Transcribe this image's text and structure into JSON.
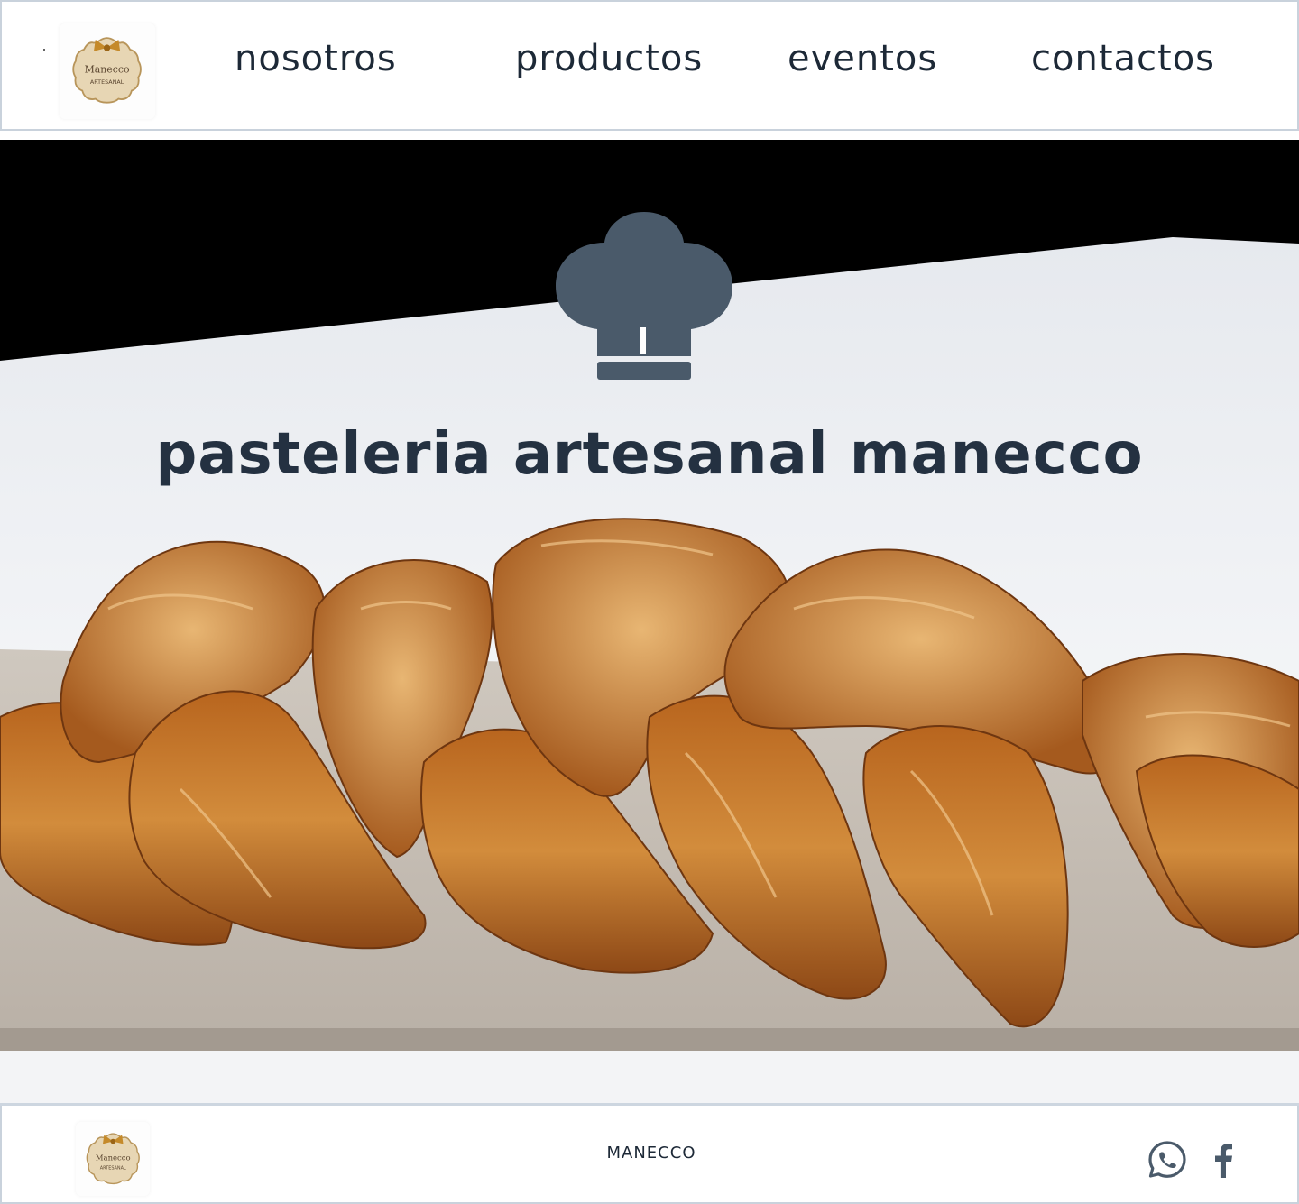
{
  "brand": {
    "logo_top_text": "Manecco",
    "logo_bottom_text": "ARTESANAL"
  },
  "nav": {
    "items": [
      {
        "label": "nosotros"
      },
      {
        "label": "productos"
      },
      {
        "label": "eventos"
      },
      {
        "label": "contactos"
      }
    ]
  },
  "hero": {
    "icon": "chef-hat-icon",
    "title": "pasteleria artesanal manecco"
  },
  "footer": {
    "brand": "MANECCO",
    "social": [
      "whatsapp-icon",
      "facebook-icon"
    ]
  },
  "colors": {
    "text": "#1d2937",
    "icon": "#4a5a6a",
    "border": "#c9d2dc"
  }
}
